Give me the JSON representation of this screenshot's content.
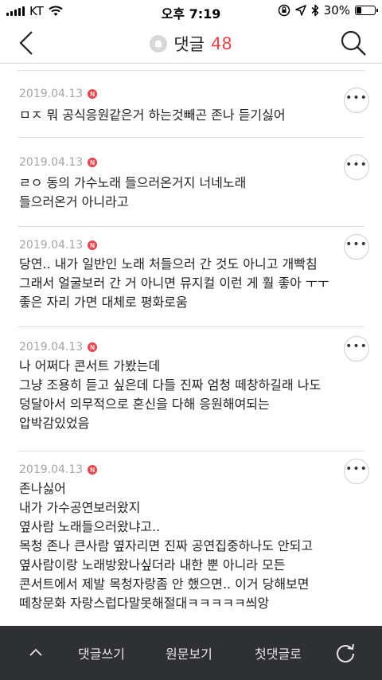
{
  "status_bar": {
    "carrier": "KT",
    "time": "오후 7:19",
    "battery_percent": "30%",
    "battery_level": 0.3
  },
  "header": {
    "title": "댓글",
    "count": "48"
  },
  "comments": [
    {
      "date": "2019.04.13",
      "badge": "N",
      "lines": [
        "ㅁㅈ 뭐 공식응원같은거 하는것빼곤 존나 듣기싫어"
      ]
    },
    {
      "date": "2019.04.13",
      "badge": "N",
      "lines": [
        "ㄹㅇ 동의 가수노래 들으러온거지 너네노래",
        "들으러온거 아니라고"
      ]
    },
    {
      "date": "2019.04.13",
      "badge": "N",
      "lines": [
        "당연.. 내가 일반인 노래 처들으러 간 것도 아니고 개빡침",
        "그래서 얼굴보러 간 거 아니면 뮤지컬 이런 게 훨 좋아 ㅜㅜ",
        "좋은 자리 가면 대체로 평화로움"
      ]
    },
    {
      "date": "2019.04.13",
      "badge": "N",
      "lines": [
        "나 어쩌다 콘서트 가봤는데",
        "그냥 조용히 듣고 싶은데 다들 진짜 엄청 떼창하길래 나도",
        "덩달아서 의무적으로 혼신을 다해 응원해여되는",
        "압박감있었음"
      ]
    },
    {
      "date": "2019.04.13",
      "badge": "N",
      "lines": [
        "존나싫어",
        "내가 가수공연보러왔지",
        "옆사람 노래들으러왔냐고..",
        "목청 존나 큰사람 옆자리면 진짜 공연집중하나도 안되고",
        "옆사람이랑 노래방왔나싶더라 내한 뿐 아니라 모든",
        "콘서트에서 제발 목청자랑좀 안 했으면.. 이거 당해보면",
        "떼창문화 자랑스럽다말못해절대ㅋㅋㅋㅋㅋ씌앙"
      ]
    }
  ],
  "bottom_bar": {
    "write": "댓글쓰기",
    "original": "원문보기",
    "first": "첫댓글로"
  }
}
